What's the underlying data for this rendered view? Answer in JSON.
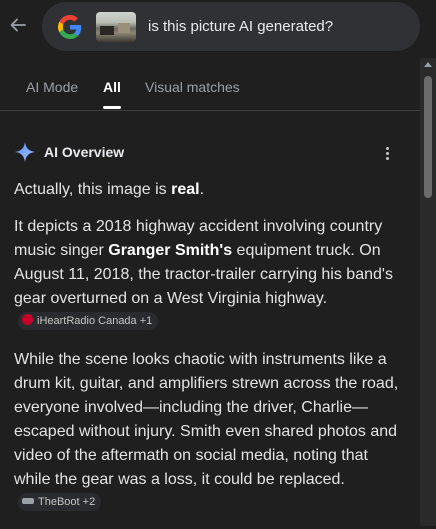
{
  "search": {
    "query": "is this picture AI generated?"
  },
  "tabs": [
    {
      "label": "AI Mode"
    },
    {
      "label": "All"
    },
    {
      "label": "Visual matches"
    }
  ],
  "ai_overview": {
    "title": "AI Overview",
    "p1_a": "Actually, this image is ",
    "p1_b": "real",
    "p1_c": ".",
    "p2_a": "It depicts a 2018 highway accident involving country music singer ",
    "p2_b": "Granger Smith's",
    "p2_c": " equipment truck. On August 11, 2018, the tractor-trailer carrying his band's gear overturned on a West Virginia highway.",
    "p2_source": "iHeartRadio Canada +1",
    "p3_a": "While the scene looks chaotic with instruments like a drum kit, guitar, and amplifiers strewn across the road, everyone involved—including the driver, Charlie—escaped without injury. Smith even shared photos and video of the aftermath on social media, noting that while the gear was a loss, it could be replaced.",
    "p3_source": "TheBoot +2"
  },
  "colors": {
    "background": "#1f1f1f",
    "searchbox": "#303134",
    "text": "#e3e3e3",
    "muted": "#9aa0a6"
  }
}
